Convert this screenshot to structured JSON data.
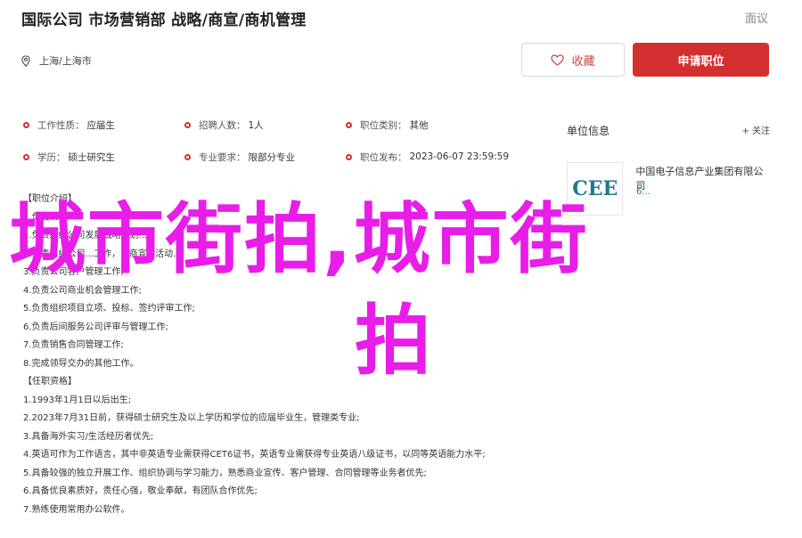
{
  "header": {
    "title": "国际公司 市场营销部 战略/商宣/商机管理",
    "report": "面议",
    "location": "上海/上海市",
    "fav_label": "收藏",
    "apply_label": "申请职位"
  },
  "info": [
    [
      {
        "label": "工作性质：",
        "value": "应届生"
      },
      {
        "label": "招聘人数：",
        "value": "1人"
      },
      {
        "label": "职位类别：",
        "value": "其他"
      }
    ],
    [
      {
        "label": "学历：",
        "value": "硕士研究生"
      },
      {
        "label": "专业要求：",
        "value": "限部分专业"
      },
      {
        "label": "职位发布：",
        "value": "2023-06-07 23:59:59"
      }
    ]
  ],
  "company": {
    "title": "单位信息",
    "close": "+ 关注",
    "logo_text": "CEE",
    "name": "中国电子信息产业集团有限公司",
    "meta": "6..."
  },
  "description": {
    "lines": [
      "【职位介绍】",
      "1.负责...",
      "1.负责组织公司发展战略规划...",
      "2.负责组织公司...工作，...商宣...活动...",
      "3.负责公司客户管理工作;",
      "4.负责公司商业机会管理工作;",
      "5.负责组织项目立项、投标、签约评审工作;",
      "6.负责后间服务公司评审与管理工作;",
      "7.负责销售合同管理工作;",
      "8.完成领导交办的其他工作。",
      "【任职资格】",
      "1.1993年1月1日以后出生;",
      "2.2023年7月31日前，获得硕士研究生及以上学历和学位的应届毕业生，管理类专业;",
      "3.具备海外实习/生活经历者优先;",
      "4.英语可作为工作语言，其中非英语专业需获得CET6证书，英语专业需获得专业英语八级证书，以同等英语能力水平;",
      "5.具备较强的独立开展工作、组织协调与学习能力，熟悉商业宣传、客户管理、合同管理等业务者优先;",
      "6.具备优良素质好，责任心强，敬业奉献，有团队合作优先;",
      "7.熟练使用常用办公软件。"
    ]
  },
  "overlay": {
    "line1": "城市街拍,城市街",
    "line2": "拍"
  },
  "colors": {
    "accent": "#d42f2f",
    "overlay": "#e81ee8",
    "logo": "#1f7a8a"
  }
}
